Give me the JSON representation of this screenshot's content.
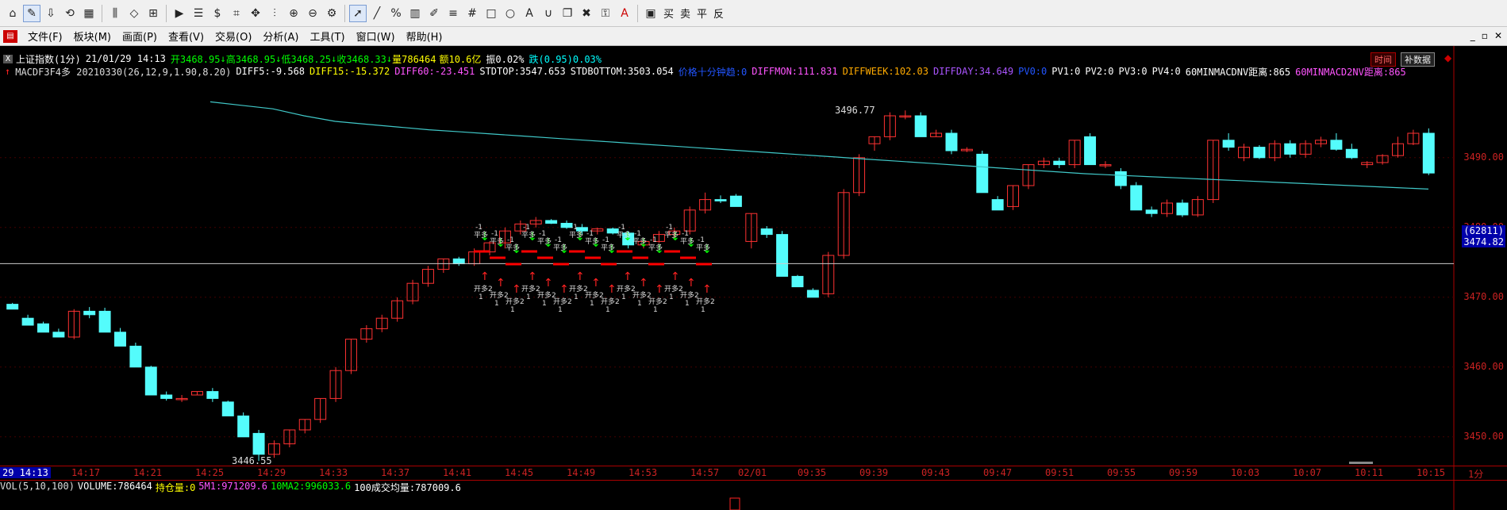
{
  "toolbar": {
    "icons": [
      "home-icon",
      "draw-icon",
      "download-icon",
      "sync-icon",
      "layout-icon",
      "bars-icon",
      "diamond-icon",
      "grid-icon",
      "play-icon",
      "note-icon",
      "dollar-icon",
      "scan-icon",
      "pan-icon",
      "caliper-icon",
      "zoom-in-icon",
      "zoom-out-icon",
      "settings-icon",
      "cursor-icon",
      "line-icon",
      "percent-icon",
      "table-icon",
      "pen-icon",
      "hlines-icon",
      "hash-icon",
      "rect-icon",
      "circle-icon",
      "text-a-icon",
      "magnet-icon",
      "copy-icon",
      "trash-icon",
      "lock-icon",
      "font-a-icon",
      "box-icon"
    ],
    "trade_labels": [
      "买",
      "卖",
      "平",
      "反"
    ]
  },
  "menu": {
    "items": [
      "文件(F)",
      "板块(M)",
      "画面(P)",
      "查看(V)",
      "交易(O)",
      "分析(A)",
      "工具(T)",
      "窗口(W)",
      "帮助(H)"
    ]
  },
  "info_line1": {
    "name": "上证指数(1分)",
    "datetime": "21/01/29 14:13",
    "open": "开3468.95",
    "high": "高3468.95",
    "low": "低3468.25",
    "close": "收3468.33",
    "volume": "量786464",
    "amount": "额10.6亿",
    "amp": "振0.02%",
    "chg": "跌(0.95)0.03%"
  },
  "buttons": {
    "time_sharing": "时间",
    "supplement": "补数据"
  },
  "info_line2": [
    {
      "text": "MACDF3F4多 20210330(26,12,9,1.90,8.20)",
      "color": "#dddddd"
    },
    {
      "text": "DIFF5:-9.568",
      "color": "#ffffff"
    },
    {
      "text": "DIFF15:-15.372",
      "color": "#ffff00"
    },
    {
      "text": "DIFF60:-23.451",
      "color": "#ff55ff"
    },
    {
      "text": "STDTOP:3547.653",
      "color": "#ffffff"
    },
    {
      "text": "STDBOTTOM:3503.054",
      "color": "#ffffff"
    },
    {
      "text": "价格十分钟趋:0",
      "color": "#2255ff"
    },
    {
      "text": "DIFFMON:111.831",
      "color": "#ff55ff"
    },
    {
      "text": "DIFFWEEK:102.03",
      "color": "#ffaa00"
    },
    {
      "text": "DIFFDAY:34.649",
      "color": "#aa55ff"
    },
    {
      "text": "PV0:0",
      "color": "#2255ff"
    },
    {
      "text": "PV1:0",
      "color": "#ffffff"
    },
    {
      "text": "PV2:0",
      "color": "#ffffff"
    },
    {
      "text": "PV3:0",
      "color": "#ffffff"
    },
    {
      "text": "PV4:0",
      "color": "#ffffff"
    },
    {
      "text": "60MINMACDNV距离:865",
      "color": "#ffffff"
    },
    {
      "text": "60MINMACD2NV距离:865",
      "color": "#ff55ff"
    }
  ],
  "chart_data": {
    "type": "candlestick",
    "y_ticks": [
      3450,
      3460,
      3470,
      3480,
      3490
    ],
    "y_tick_labels": [
      "3450.00",
      "3460.00",
      "3470.00",
      "3480.00",
      "3490.00"
    ],
    "ylim": [
      3446,
      3501
    ],
    "current_price_label": "3474.82",
    "current_count_label": "(62811)",
    "annotations": {
      "high": "3496.77",
      "low": "3446.55"
    },
    "x_labels": [
      "14:17",
      "14:21",
      "14:25",
      "14:29",
      "14:33",
      "14:37",
      "14:41",
      "14:45",
      "14:49",
      "14:53",
      "14:57",
      "02/01",
      "09:35",
      "09:39",
      "09:43",
      "09:47",
      "09:51",
      "09:55",
      "09:59",
      "10:03",
      "10:07",
      "10:11",
      "10:15",
      "1分"
    ],
    "x_current": "29 14:13",
    "candles": [
      [
        3469.0,
        3469.2,
        3468.3,
        3468.3
      ],
      [
        3467.0,
        3467.5,
        3466.0,
        3466.0
      ],
      [
        3466.2,
        3466.5,
        3465.0,
        3465.0
      ],
      [
        3465.0,
        3465.5,
        3464.3,
        3464.3
      ],
      [
        3464.3,
        3468.3,
        3464.0,
        3468.0
      ],
      [
        3468.0,
        3468.6,
        3467.0,
        3467.5
      ],
      [
        3468.0,
        3468.5,
        3465.0,
        3465.0
      ],
      [
        3465.0,
        3465.6,
        3463.0,
        3463.0
      ],
      [
        3463.0,
        3463.5,
        3460.0,
        3460.0
      ],
      [
        3460.0,
        3460.2,
        3456.0,
        3456.0
      ],
      [
        3456.0,
        3456.5,
        3455.2,
        3455.5
      ],
      [
        3455.5,
        3456.0,
        3455.0,
        3455.5
      ],
      [
        3456.0,
        3456.5,
        3456.0,
        3456.5
      ],
      [
        3456.5,
        3457.0,
        3455.0,
        3455.5
      ],
      [
        3455.0,
        3455.2,
        3453.0,
        3453.0
      ],
      [
        3453.0,
        3453.5,
        3450.0,
        3450.0
      ],
      [
        3450.5,
        3451.0,
        3446.55,
        3447.5
      ],
      [
        3447.5,
        3449.5,
        3447.0,
        3449.0
      ],
      [
        3449.0,
        3451.0,
        3448.5,
        3451.0
      ],
      [
        3451.0,
        3452.5,
        3450.5,
        3452.5
      ],
      [
        3452.5,
        3455.5,
        3452.0,
        3455.5
      ],
      [
        3455.5,
        3460.0,
        3455.0,
        3459.5
      ],
      [
        3459.5,
        3464.0,
        3459.0,
        3464.0
      ],
      [
        3464.0,
        3466.0,
        3463.5,
        3465.5
      ],
      [
        3465.5,
        3467.5,
        3465.0,
        3467.0
      ],
      [
        3467.0,
        3470.0,
        3466.5,
        3469.5
      ],
      [
        3469.5,
        3472.5,
        3469.0,
        3472.0
      ],
      [
        3472.0,
        3474.5,
        3471.5,
        3474.0
      ],
      [
        3474.0,
        3475.5,
        3473.5,
        3475.5
      ],
      [
        3475.5,
        3475.8,
        3474.5,
        3474.8
      ],
      [
        3474.8,
        3477.0,
        3474.5,
        3476.5
      ],
      [
        3476.5,
        3478.0,
        3476.0,
        3477.8
      ],
      [
        3477.8,
        3480.0,
        3477.0,
        3479.5
      ],
      [
        3479.5,
        3481.0,
        3479.0,
        3480.5
      ],
      [
        3480.5,
        3481.5,
        3480.0,
        3481.0
      ],
      [
        3481.0,
        3481.2,
        3480.5,
        3480.6
      ],
      [
        3480.6,
        3481.0,
        3479.8,
        3480.0
      ],
      [
        3480.0,
        3480.5,
        3479.0,
        3479.5
      ],
      [
        3479.5,
        3480.0,
        3479.0,
        3479.8
      ],
      [
        3479.8,
        3480.0,
        3479.0,
        3479.2
      ],
      [
        3479.2,
        3479.5,
        3477.0,
        3477.5
      ],
      [
        3477.5,
        3478.5,
        3477.0,
        3478.0
      ],
      [
        3478.0,
        3479.5,
        3477.8,
        3479.0
      ],
      [
        3479.0,
        3480.0,
        3478.5,
        3479.5
      ],
      [
        3479.5,
        3483.0,
        3479.0,
        3482.5
      ],
      [
        3482.5,
        3485.0,
        3482.0,
        3484.0
      ],
      [
        3484.0,
        3484.6,
        3483.5,
        3483.8
      ],
      [
        3484.5,
        3484.8,
        3483.0,
        3483.0
      ],
      [
        3478.0,
        3482.0,
        3477.0,
        3482.0
      ],
      [
        3479.8,
        3480.2,
        3478.5,
        3479.0
      ],
      [
        3479.0,
        3479.5,
        3473.0,
        3473.0
      ],
      [
        3473.0,
        3473.2,
        3471.5,
        3471.5
      ],
      [
        3471.0,
        3471.3,
        3470.0,
        3470.0
      ],
      [
        3470.5,
        3476.5,
        3470.0,
        3476.0
      ],
      [
        3476.0,
        3485.5,
        3475.5,
        3485.0
      ],
      [
        3485.0,
        3490.5,
        3484.5,
        3490.0
      ],
      [
        3492.0,
        3493.0,
        3491.0,
        3493.0
      ],
      [
        3493.0,
        3496.5,
        3492.5,
        3496.0
      ],
      [
        3496.0,
        3496.77,
        3495.5,
        3496.0
      ],
      [
        3496.0,
        3496.5,
        3493.0,
        3493.0
      ],
      [
        3493.0,
        3494.0,
        3493.0,
        3493.5
      ],
      [
        3493.5,
        3494.0,
        3490.5,
        3491.0
      ],
      [
        3491.0,
        3491.5,
        3490.8,
        3491.2
      ],
      [
        3490.5,
        3491.0,
        3485.0,
        3485.0
      ],
      [
        3484.0,
        3484.5,
        3482.5,
        3482.5
      ],
      [
        3483.0,
        3486.0,
        3482.5,
        3486.0
      ],
      [
        3486.0,
        3489.0,
        3485.5,
        3489.0
      ],
      [
        3489.0,
        3490.0,
        3488.5,
        3489.5
      ],
      [
        3489.5,
        3490.0,
        3488.5,
        3489.0
      ],
      [
        3489.0,
        3492.5,
        3488.5,
        3492.5
      ],
      [
        3493.0,
        3493.5,
        3489.0,
        3489.0
      ],
      [
        3489.0,
        3489.5,
        3488.5,
        3489.0
      ],
      [
        3488.0,
        3488.5,
        3485.5,
        3486.0
      ],
      [
        3486.0,
        3486.5,
        3482.5,
        3482.5
      ],
      [
        3482.5,
        3483.0,
        3481.5,
        3482.0
      ],
      [
        3482.0,
        3484.0,
        3481.5,
        3483.5
      ],
      [
        3483.5,
        3484.0,
        3481.5,
        3481.8
      ],
      [
        3481.8,
        3484.5,
        3481.5,
        3484.0
      ],
      [
        3484.0,
        3492.5,
        3483.5,
        3492.5
      ],
      [
        3492.5,
        3493.5,
        3491.0,
        3491.5
      ],
      [
        3490.0,
        3492.0,
        3489.5,
        3491.5
      ],
      [
        3491.5,
        3491.8,
        3489.8,
        3490.0
      ],
      [
        3490.0,
        3492.5,
        3489.5,
        3492.0
      ],
      [
        3492.0,
        3492.5,
        3490.0,
        3490.5
      ],
      [
        3490.5,
        3492.5,
        3490.0,
        3492.0
      ],
      [
        3492.0,
        3493.0,
        3491.5,
        3492.5
      ],
      [
        3492.5,
        3493.5,
        3491.0,
        3491.2
      ],
      [
        3491.2,
        3492.0,
        3489.8,
        3490.0
      ],
      [
        3489.0,
        3489.5,
        3488.5,
        3489.3
      ],
      [
        3489.3,
        3490.5,
        3489.0,
        3490.3
      ],
      [
        3490.3,
        3493.0,
        3490.0,
        3492.0
      ],
      [
        3492.0,
        3494.0,
        3491.8,
        3493.5
      ],
      [
        3493.5,
        3494.2,
        3487.5,
        3487.8
      ]
    ],
    "ma_line": [
      3498,
      3497.5,
      3497,
      3496,
      3495.2,
      3494.8,
      3494.4,
      3494.0,
      3493.7,
      3493.4,
      3493.1,
      3492.8,
      3492.5,
      3492.2,
      3491.9,
      3491.6,
      3491.3,
      3491.0,
      3490.7,
      3490.4,
      3490.1,
      3489.8,
      3489.5,
      3489.2,
      3488.9,
      3488.6,
      3488.3,
      3488.0,
      3487.7,
      3487.5,
      3487.3,
      3487.1,
      3486.9,
      3486.7,
      3486.5,
      3486.3,
      3486.1,
      3485.9,
      3485.7,
      3485.5
    ],
    "signals": {
      "buy_label": "开多2",
      "sell_label": "平多",
      "open_label": "开多",
      "num_label": "1",
      "neg_label": "-1"
    }
  },
  "volume_row": [
    {
      "text": "VOL(5,10,100)",
      "color": "#dddddd"
    },
    {
      "text": "VOLUME:786464",
      "color": "#ffffff"
    },
    {
      "text": "持仓量:0",
      "color": "#ffff00"
    },
    {
      "text": "5M1:971209.6",
      "color": "#ff55ff"
    },
    {
      "text": "10MA2:996033.6",
      "color": "#00ff00"
    },
    {
      "text": "100成交均量:787009.6",
      "color": "#ffffff"
    }
  ]
}
